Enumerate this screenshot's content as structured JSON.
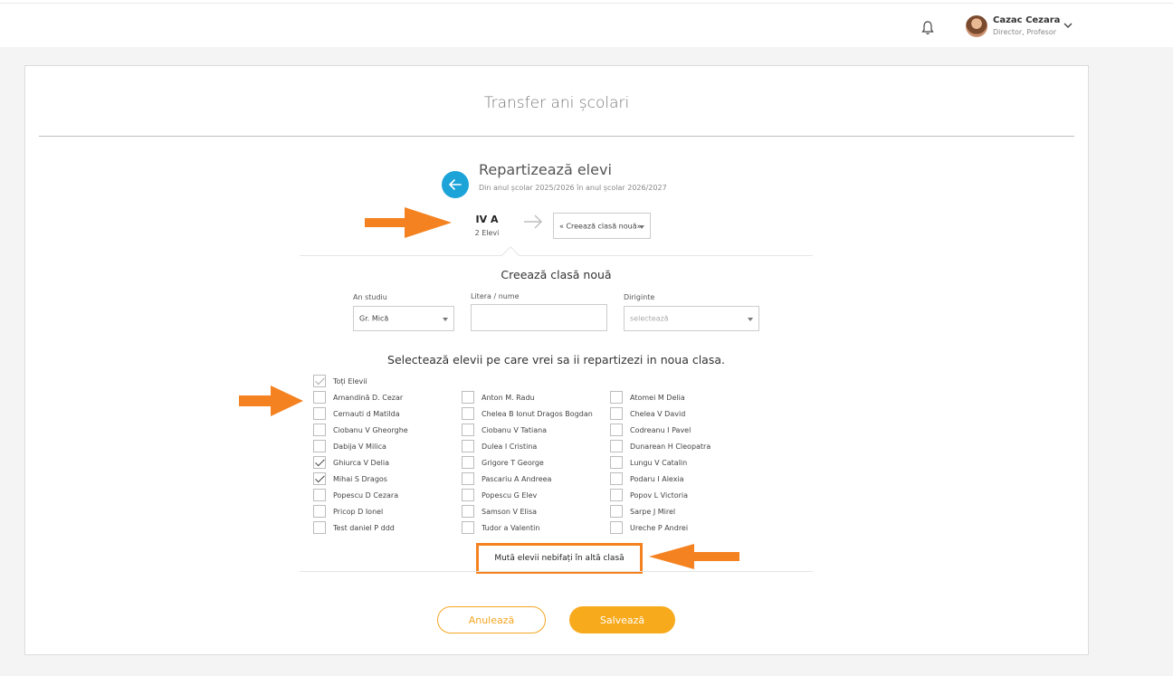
{
  "header": {
    "user_name": "Cazac Cezara",
    "user_role": "Director, Profesor"
  },
  "page": {
    "title": "Transfer ani școlari"
  },
  "section": {
    "title": "Repartizează elevi",
    "subtitle": "Din anul școlar 2025/2026 în anul școlar 2026/2027"
  },
  "source_class": {
    "name": "IV A",
    "count": "2 Elevi"
  },
  "target_class": {
    "selected": "« Creează clasă nouă»"
  },
  "new_class": {
    "title": "Creează clasă nouă",
    "an_studiu_label": "An studiu",
    "an_studiu_value": "Gr. Mică",
    "litera_label": "Litera / nume",
    "litera_value": "",
    "diriginte_label": "Diriginte",
    "diriginte_placeholder": "selectează"
  },
  "students": {
    "instruction": "Selectează elevii pe care vrei sa ii repartizezi in noua clasa.",
    "all_label": "Toți Elevii",
    "all_checked": true,
    "columns": [
      [
        {
          "name": "Amandină D. Cezar",
          "checked": false
        },
        {
          "name": "Cernauti d Matilda",
          "checked": false
        },
        {
          "name": "Ciobanu V Gheorghe",
          "checked": false
        },
        {
          "name": "Dabija V Milica",
          "checked": false
        },
        {
          "name": "Ghiurca V Delia",
          "checked": true
        },
        {
          "name": "Mihai S Dragos",
          "checked": true
        },
        {
          "name": "Popescu D Cezara",
          "checked": false
        },
        {
          "name": "Pricop D Ionel",
          "checked": false
        },
        {
          "name": "Test daniel P ddd",
          "checked": false
        }
      ],
      [
        {
          "name": "Anton M. Radu",
          "checked": false
        },
        {
          "name": "Chelea B Ionut Dragos Bogdan",
          "checked": false
        },
        {
          "name": "Ciobanu V Tatiana",
          "checked": false
        },
        {
          "name": "Dulea I Cristina",
          "checked": false
        },
        {
          "name": "Grigore T George",
          "checked": false
        },
        {
          "name": "Pascariu A Andreea",
          "checked": false
        },
        {
          "name": "Popescu G Elev",
          "checked": false
        },
        {
          "name": "Samson V Elisa",
          "checked": false
        },
        {
          "name": "Tudor a Valentin",
          "checked": false
        }
      ],
      [
        {
          "name": "Atomei M Delia",
          "checked": false
        },
        {
          "name": "Chelea V David",
          "checked": false
        },
        {
          "name": "Codreanu I Pavel",
          "checked": false
        },
        {
          "name": "Dunarean H Cleopatra",
          "checked": false
        },
        {
          "name": "Lungu V Catalin",
          "checked": false
        },
        {
          "name": "Podaru I Alexia",
          "checked": false
        },
        {
          "name": "Popov L Victoria",
          "checked": false
        },
        {
          "name": "Sarpe J Mirel",
          "checked": false
        },
        {
          "name": "Ureche P Andrei",
          "checked": false
        }
      ]
    ]
  },
  "actions": {
    "move_unchecked": "Mută elevii nebifați în altă clasă",
    "cancel": "Anulează",
    "save": "Salvează"
  },
  "colors": {
    "accent_orange": "#f58220",
    "button_yellow": "#f7aa1c",
    "back_blue": "#1ca3d8"
  }
}
